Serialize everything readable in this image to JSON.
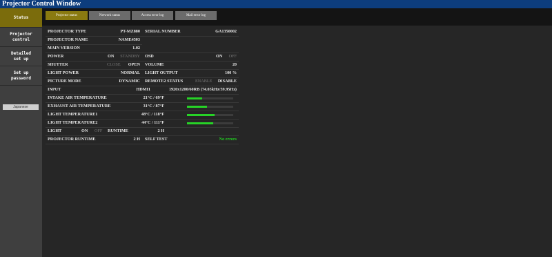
{
  "window_title": "Projector Control Window",
  "sidebar": {
    "items": [
      {
        "label": "Status"
      },
      {
        "label": "Projector control"
      },
      {
        "label": "Detailed set up"
      },
      {
        "label": "Set up password"
      }
    ],
    "language_button": "Japanese"
  },
  "tabs": [
    {
      "label": "Projector status"
    },
    {
      "label": "Network status"
    },
    {
      "label": "Access error log"
    },
    {
      "label": "Mail error log"
    }
  ],
  "status": {
    "projector_type": {
      "label": "PROJECTOR TYPE",
      "value": "PT-MZ880"
    },
    "serial_number": {
      "label": "SERIAL NUMBER",
      "value": "GA1350002"
    },
    "projector_name": {
      "label": "PROJECTOR NAME",
      "value": "NAME4503"
    },
    "main_version": {
      "label": "MAIN VERSION",
      "value": "1.02"
    },
    "power": {
      "label": "POWER",
      "on": "ON",
      "standby": "STANDBY"
    },
    "osd": {
      "label": "OSD",
      "on": "ON",
      "off": "OFF"
    },
    "shutter": {
      "label": "SHUTTER",
      "close": "CLOSE",
      "open": "OPEN"
    },
    "volume": {
      "label": "VOLUME",
      "value": "20"
    },
    "light_power": {
      "label": "LIGHT POWER",
      "value": "NORMAL"
    },
    "light_output": {
      "label": "LIGHT OUTPUT",
      "value": "100 %"
    },
    "picture_mode": {
      "label": "PICTURE MODE",
      "value": "DYNAMIC"
    },
    "remote2": {
      "label": "REMOTE2 STATUS",
      "enable": "ENABLE",
      "disable": "DISABLE"
    },
    "input": {
      "label": "INPUT",
      "value": "HDMI1",
      "signal": "1920x1200/60RB (74.03kHz/59.95Hz)"
    },
    "temps": [
      {
        "label": "INTAKE AIR TEMPERATURE",
        "value": "21°C / 69°F",
        "level": 0.33
      },
      {
        "label": "EXHAUST AIR TEMPERATURE",
        "value": "31°C / 87°F",
        "level": 0.44
      },
      {
        "label": "LIGHT TEMPERATURE1",
        "value": "48°C / 118°F",
        "level": 0.6
      },
      {
        "label": "LIGHT TEMPERATURE2",
        "value": "44°C / 111°F",
        "level": 0.56
      }
    ],
    "light": {
      "label": "LIGHT",
      "on": "ON",
      "off": "OFF",
      "runtime_label": "RUNTIME",
      "runtime_value": "2 H"
    },
    "projector_runtime": {
      "label": "PROJECTOR RUNTIME",
      "value": "2 H"
    },
    "self_test": {
      "label": "SELF TEST",
      "value": "No errors"
    }
  },
  "colors": {
    "accent": "#8a7a10",
    "title_bar": "#0d3d7d",
    "ok": "#22cc22"
  }
}
